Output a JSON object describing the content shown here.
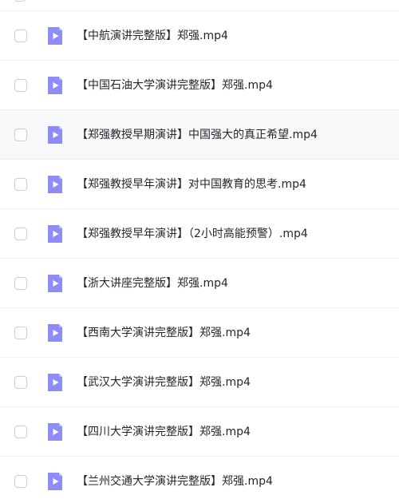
{
  "colors": {
    "row_divider": "#f0f0f2",
    "row_hover_background": "#f7f8fa",
    "checkbox_border": "#c9cdd4",
    "file_icon_fill": "#8d8cf5",
    "file_icon_fold": "#b6b5fb",
    "file_name_text": "#25262b"
  },
  "icons": {
    "file_type": "video-file-icon",
    "play": "play-icon"
  },
  "files": [
    {
      "name": "【中航演讲完整版】郑强.mp4",
      "checked": false
    },
    {
      "name": "【中国石油大学演讲完整版】郑强.mp4",
      "checked": false
    },
    {
      "name": "【郑强教授早期演讲】中国强大的真正希望.mp4",
      "checked": false,
      "hovered": true
    },
    {
      "name": "【郑强教授早年演讲】对中国教育的思考.mp4",
      "checked": false
    },
    {
      "name": "【郑强教授早年演讲】（2小时高能预警）.mp4",
      "checked": false
    },
    {
      "name": "【浙大讲座完整版】郑强.mp4",
      "checked": false
    },
    {
      "name": "【西南大学演讲完整版】郑强.mp4",
      "checked": false
    },
    {
      "name": "【武汉大学演讲完整版】郑强.mp4",
      "checked": false
    },
    {
      "name": "【四川大学演讲完整版】郑强.mp4",
      "checked": false
    },
    {
      "name": "【兰州交通大学演讲完整版】郑强.mp4",
      "checked": false
    }
  ]
}
